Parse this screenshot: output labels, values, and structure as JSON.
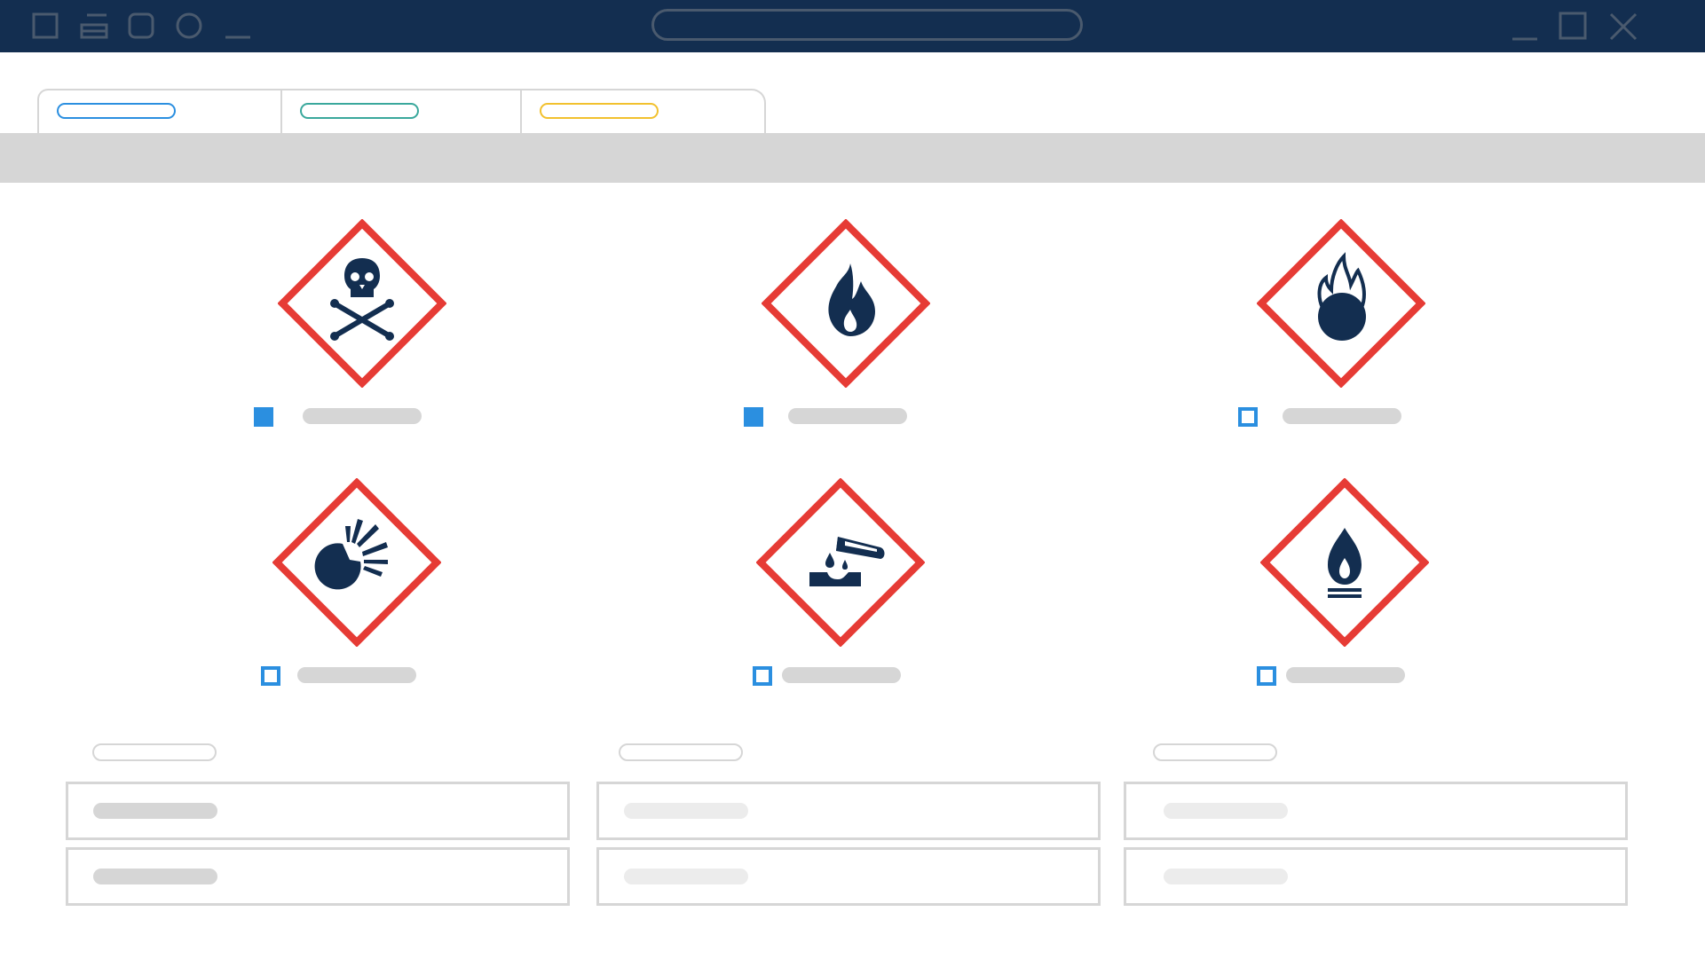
{
  "window": {
    "controls": [
      "minimize-icon",
      "maximize-icon",
      "close-icon"
    ],
    "left_icons": [
      "square-icon",
      "layout-icon",
      "rounded-square-icon",
      "circle-icon",
      "underscore-icon"
    ],
    "address_bar": ""
  },
  "tabs": [
    {
      "label": "",
      "accent": "#2b8fe0"
    },
    {
      "label": "",
      "accent": "#3aa89c"
    },
    {
      "label": "",
      "accent": "#f2c12e"
    }
  ],
  "hazards": [
    {
      "icon": "skull-crossbones-icon",
      "label": "",
      "checked": true
    },
    {
      "icon": "flame-icon",
      "label": "",
      "checked": true
    },
    {
      "icon": "flame-over-circle-icon",
      "label": "",
      "checked": false
    },
    {
      "icon": "exploding-bomb-icon",
      "label": "",
      "checked": false
    },
    {
      "icon": "corrosion-icon",
      "label": "",
      "checked": false
    },
    {
      "icon": "flammable-liquid-icon",
      "label": "",
      "checked": false
    }
  ],
  "fields": [
    {
      "label": "",
      "values": [
        "",
        ""
      ]
    },
    {
      "label": "",
      "values": [
        "",
        ""
      ]
    },
    {
      "label": "",
      "values": [
        "",
        ""
      ]
    }
  ],
  "colors": {
    "titlebar": "#132e50",
    "hazard_border": "#e63b35",
    "pictogram": "#132e50",
    "accent": "#2b8fe0",
    "placeholder": "#d6d6d6",
    "placeholder_light": "#ececec"
  }
}
